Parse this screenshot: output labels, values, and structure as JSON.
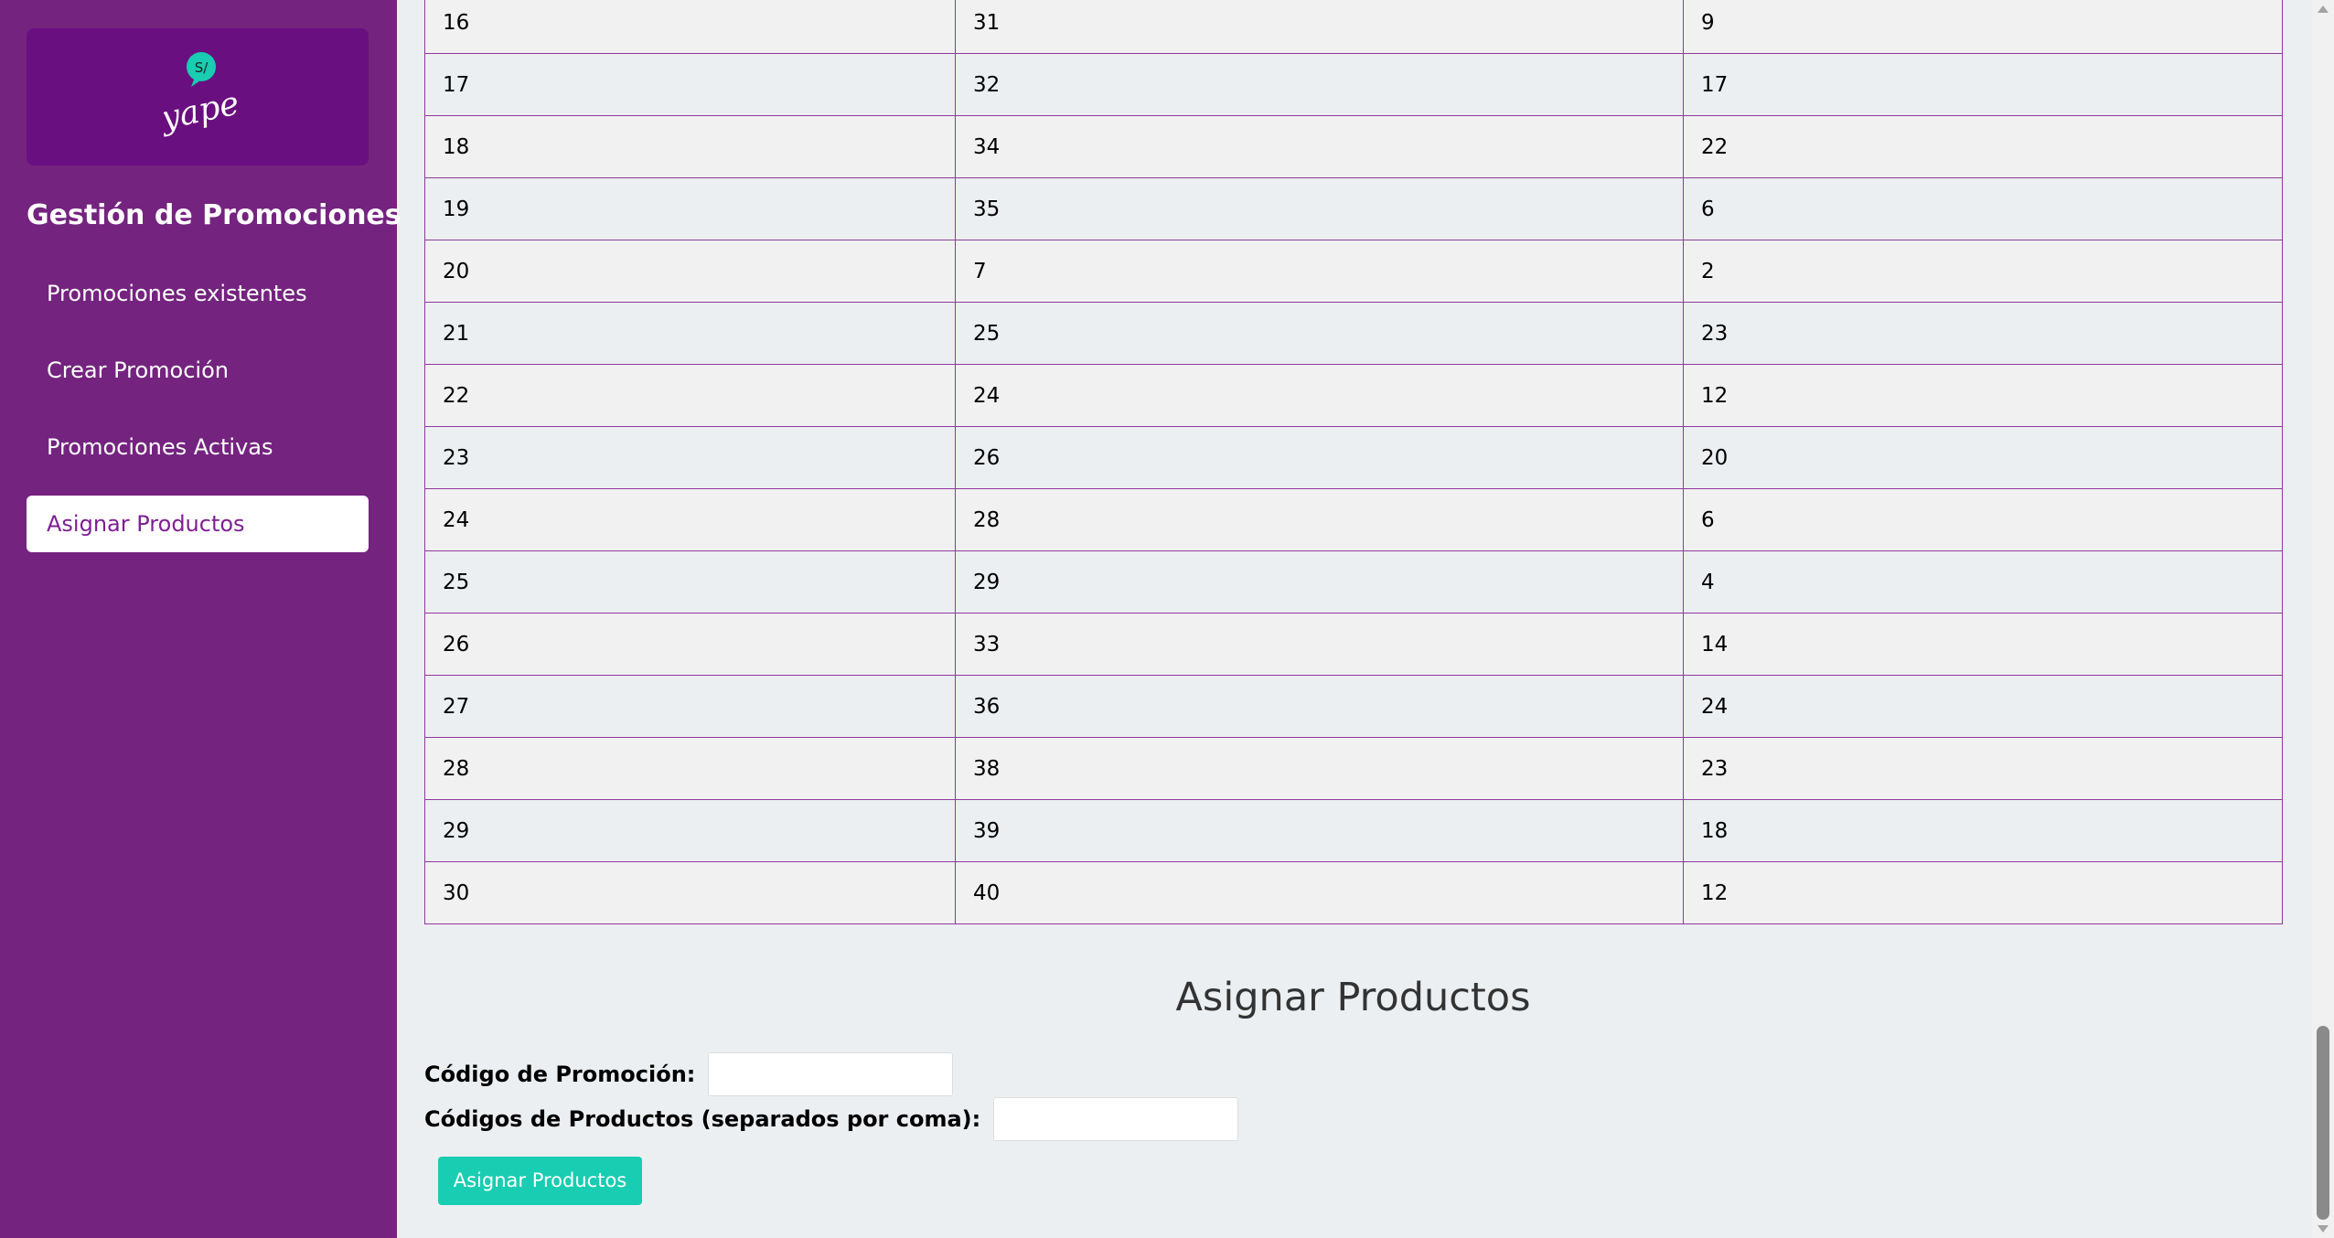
{
  "sidebar": {
    "logo_text": "yape",
    "logo_badge": "S/",
    "title": "Gestión de Promociones",
    "items": [
      {
        "label": "Promociones existentes"
      },
      {
        "label": "Crear Promoción"
      },
      {
        "label": "Promociones Activas"
      },
      {
        "label": "Asignar Productos"
      }
    ]
  },
  "table": {
    "rows": [
      [
        "16",
        "31",
        "9"
      ],
      [
        "17",
        "32",
        "17"
      ],
      [
        "18",
        "34",
        "22"
      ],
      [
        "19",
        "35",
        "6"
      ],
      [
        "20",
        "7",
        "2"
      ],
      [
        "21",
        "25",
        "23"
      ],
      [
        "22",
        "24",
        "12"
      ],
      [
        "23",
        "26",
        "20"
      ],
      [
        "24",
        "28",
        "6"
      ],
      [
        "25",
        "29",
        "4"
      ],
      [
        "26",
        "33",
        "14"
      ],
      [
        "27",
        "36",
        "24"
      ],
      [
        "28",
        "38",
        "23"
      ],
      [
        "29",
        "39",
        "18"
      ],
      [
        "30",
        "40",
        "12"
      ]
    ]
  },
  "form": {
    "title": "Asignar Productos",
    "promo_code_label": "Código de Promoción:",
    "promo_code_value": "",
    "product_codes_label": "Códigos de Productos (separados por coma):",
    "product_codes_value": "",
    "submit_label": "Asignar Productos"
  },
  "colors": {
    "sidebar_bg": "#74237F",
    "logo_bg": "#6A0F80",
    "accent_button": "#18CDB2",
    "table_border": "#8E3A9C"
  }
}
